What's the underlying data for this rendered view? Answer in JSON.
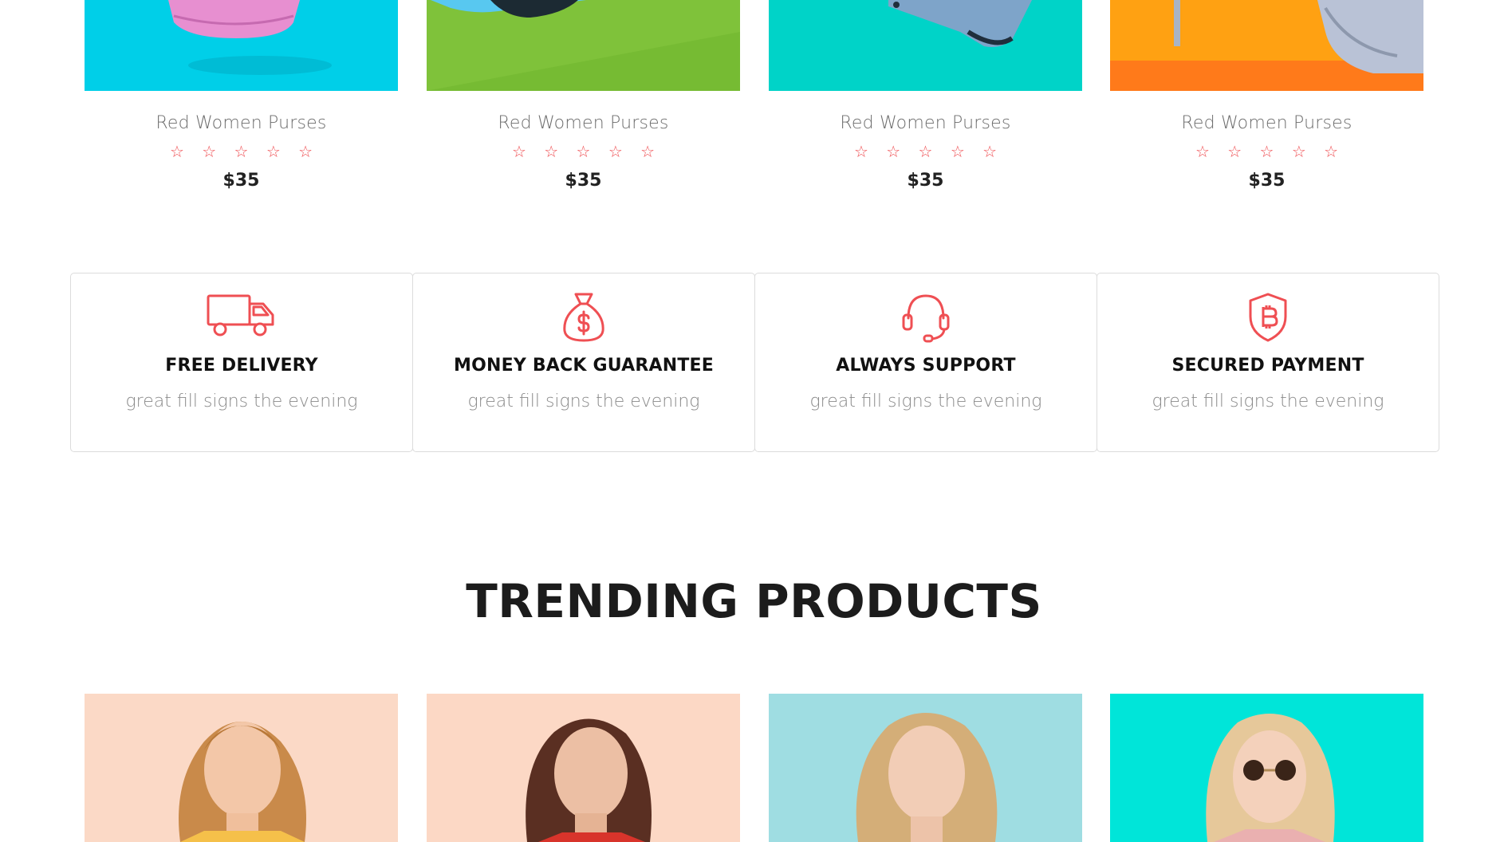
{
  "top_products": [
    {
      "title": "Red Women Purses",
      "rating": "☆ ☆ ☆ ☆ ☆",
      "price": "$35",
      "bg": "#00cfe8",
      "image": "pink-purse-image"
    },
    {
      "title": "Red Women Purses",
      "rating": "☆ ☆ ☆ ☆ ☆",
      "price": "$35",
      "bg": "#7fc23a",
      "image": "blue-purse-image"
    },
    {
      "title": "Red Women Purses",
      "rating": "☆ ☆ ☆ ☆ ☆",
      "price": "$35",
      "bg": "#00d3c8",
      "image": "denim-purse-image"
    },
    {
      "title": "Red Women Purses",
      "rating": "☆ ☆ ☆ ☆ ☆",
      "price": "$35",
      "bg": "#ffa112",
      "image": "silver-purse-image"
    }
  ],
  "features": [
    {
      "title": "FREE DELIVERY",
      "desc": "great fill signs the evening",
      "icon": "truck-icon"
    },
    {
      "title": "MONEY BACK GUARANTEE",
      "desc": "great fill signs the evening",
      "icon": "money-bag-icon"
    },
    {
      "title": "ALWAYS SUPPORT",
      "desc": "great fill signs the evening",
      "icon": "headset-icon"
    },
    {
      "title": "SECURED PAYMENT",
      "desc": "great fill signs the evening",
      "icon": "shield-bitcoin-icon"
    }
  ],
  "trending": {
    "heading": "TRENDING PRODUCTS",
    "products": [
      {
        "bg": "#fbd9c6",
        "image": "woman-portrait-1"
      },
      {
        "bg": "#fcd8c5",
        "image": "woman-portrait-2"
      },
      {
        "bg": "#9fdde2",
        "image": "woman-portrait-3"
      },
      {
        "bg": "#00e5d9",
        "image": "woman-portrait-4"
      }
    ]
  },
  "colors": {
    "accent": "#ef4f53",
    "border": "#dcdcdc"
  }
}
